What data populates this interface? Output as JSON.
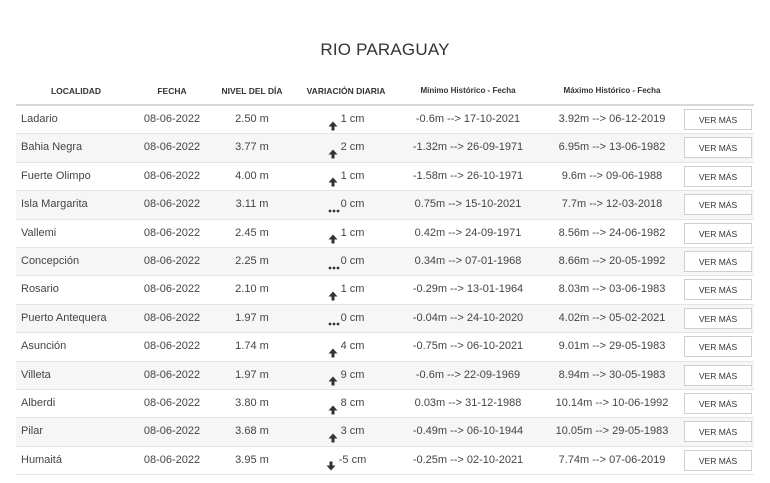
{
  "page_title": "RIO PARAGUAY",
  "headers": {
    "localidad": "LOCALIDAD",
    "fecha": "FECHA",
    "nivel": "NIVEL DEL DÍA",
    "variacion": "VARIACIÓN DIARIA",
    "minimo": "Mínimo Histórico - Fecha",
    "maximo": "Máximo Histórico - Fecha"
  },
  "button_label": "VER MÁS",
  "rows": [
    {
      "localidad": "Ladario",
      "fecha": "08-06-2022",
      "nivel": "2.50 m",
      "trend": "up",
      "variacion": "1 cm",
      "minimo": "-0.6m --> 17-10-2021",
      "maximo": "3.92m --> 06-12-2019"
    },
    {
      "localidad": "Bahia Negra",
      "fecha": "08-06-2022",
      "nivel": "3.77 m",
      "trend": "up",
      "variacion": "2 cm",
      "minimo": "-1.32m --> 26-09-1971",
      "maximo": "6.95m --> 13-06-1982"
    },
    {
      "localidad": "Fuerte Olimpo",
      "fecha": "08-06-2022",
      "nivel": "4.00 m",
      "trend": "up",
      "variacion": "1 cm",
      "minimo": "-1.58m --> 26-10-1971",
      "maximo": "9.6m --> 09-06-1988"
    },
    {
      "localidad": "Isla Margarita",
      "fecha": "08-06-2022",
      "nivel": "3.11 m",
      "trend": "flat",
      "variacion": "0 cm",
      "minimo": "0.75m --> 15-10-2021",
      "maximo": "7.7m --> 12-03-2018"
    },
    {
      "localidad": "Vallemi",
      "fecha": "08-06-2022",
      "nivel": "2.45 m",
      "trend": "up",
      "variacion": "1 cm",
      "minimo": "0.42m --> 24-09-1971",
      "maximo": "8.56m --> 24-06-1982"
    },
    {
      "localidad": "Concepción",
      "fecha": "08-06-2022",
      "nivel": "2.25 m",
      "trend": "flat",
      "variacion": "0 cm",
      "minimo": "0.34m --> 07-01-1968",
      "maximo": "8.66m --> 20-05-1992"
    },
    {
      "localidad": "Rosario",
      "fecha": "08-06-2022",
      "nivel": "2.10 m",
      "trend": "up",
      "variacion": "1 cm",
      "minimo": "-0.29m --> 13-01-1964",
      "maximo": "8.03m --> 03-06-1983"
    },
    {
      "localidad": "Puerto Antequera",
      "fecha": "08-06-2022",
      "nivel": "1.97 m",
      "trend": "flat",
      "variacion": "0 cm",
      "minimo": "-0.04m --> 24-10-2020",
      "maximo": "4.02m --> 05-02-2021"
    },
    {
      "localidad": "Asunción",
      "fecha": "08-06-2022",
      "nivel": "1.74 m",
      "trend": "up",
      "variacion": "4 cm",
      "minimo": "-0.75m --> 06-10-2021",
      "maximo": "9.01m --> 29-05-1983"
    },
    {
      "localidad": "Villeta",
      "fecha": "08-06-2022",
      "nivel": "1.97 m",
      "trend": "up",
      "variacion": "9 cm",
      "minimo": "-0.6m --> 22-09-1969",
      "maximo": "8.94m --> 30-05-1983"
    },
    {
      "localidad": "Alberdi",
      "fecha": "08-06-2022",
      "nivel": "3.80 m",
      "trend": "up",
      "variacion": "8 cm",
      "minimo": "0.03m --> 31-12-1988",
      "maximo": "10.14m --> 10-06-1992"
    },
    {
      "localidad": "Pilar",
      "fecha": "08-06-2022",
      "nivel": "3.68 m",
      "trend": "up",
      "variacion": "3 cm",
      "minimo": "-0.49m --> 06-10-1944",
      "maximo": "10.05m --> 29-05-1983"
    },
    {
      "localidad": "Humaitá",
      "fecha": "08-06-2022",
      "nivel": "3.95 m",
      "trend": "down",
      "variacion": "-5 cm",
      "minimo": "-0.25m --> 02-10-2021",
      "maximo": "7.74m --> 07-06-2019"
    }
  ]
}
